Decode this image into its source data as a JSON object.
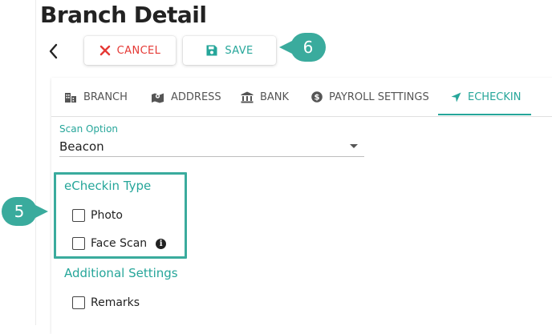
{
  "page": {
    "title": "Branch Detail"
  },
  "toolbar": {
    "cancel_label": "CANCEL",
    "save_label": "SAVE",
    "cancel_icon": "close-icon",
    "save_icon": "floppy-disk-icon",
    "back_icon": "chevron-left-icon"
  },
  "callouts": {
    "save_step": "6",
    "echeckin_type_step": "5"
  },
  "tabs": [
    {
      "label": "BRANCH",
      "icon": "building-icon"
    },
    {
      "label": "ADDRESS",
      "icon": "map-icon"
    },
    {
      "label": "BANK",
      "icon": "bank-icon"
    },
    {
      "label": "PAYROLL SETTINGS",
      "icon": "dollar-coin-icon"
    },
    {
      "label": "ECHECKIN",
      "icon": "navigation-arrow-icon"
    }
  ],
  "active_tab": "ECHECKIN",
  "scan_option": {
    "label": "Scan Option",
    "value": "Beacon"
  },
  "echeckin_type": {
    "title": "eCheckin Type",
    "options": [
      {
        "label": "Photo",
        "checked": false
      },
      {
        "label": "Face Scan",
        "checked": false
      }
    ]
  },
  "additional_settings": {
    "title": "Additional Settings",
    "options": [
      {
        "label": "Remarks",
        "checked": false
      }
    ]
  },
  "colors": {
    "accent": "#26a69a",
    "callout": "#3aab9d",
    "danger": "#e53935"
  }
}
